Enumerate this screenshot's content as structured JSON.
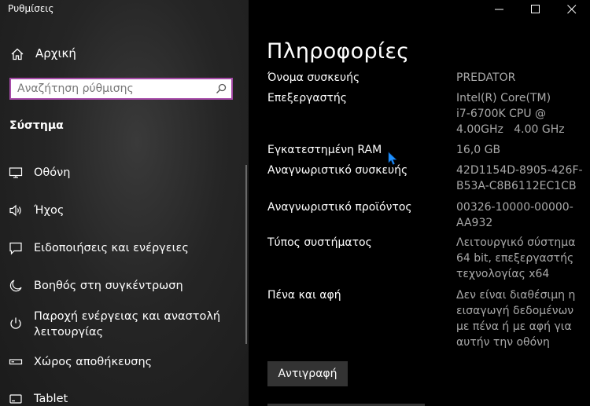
{
  "window": {
    "title": "Ρυθμίσεις"
  },
  "sidebar": {
    "home_label": "Αρχική",
    "search": {
      "placeholder": "Αναζήτηση ρύθμισης"
    },
    "section_title": "Σύστημα",
    "items": [
      {
        "label": "Οθόνη",
        "icon": "monitor-icon"
      },
      {
        "label": "Ήχος",
        "icon": "speaker-icon"
      },
      {
        "label": "Ειδοποιήσεις και ενέργειες",
        "icon": "notification-icon"
      },
      {
        "label": "Βοηθός στη συγκέντρωση",
        "icon": "moon-icon"
      },
      {
        "label_line1": "Παροχή ενέργειας και αναστολή",
        "label_line2": "λειτουργίας",
        "icon": "power-icon"
      },
      {
        "label": "Χώρος αποθήκευσης",
        "icon": "storage-icon"
      },
      {
        "label": "Tablet",
        "icon": "tablet-icon"
      }
    ]
  },
  "main": {
    "title": "Πληροφορίες",
    "specs": [
      {
        "label": "Όνομα συσκευής",
        "value": "PREDATOR"
      },
      {
        "label": "Επεξεργαστής",
        "value_lines": [
          "Intel(R) Core(TM)",
          "i7-6700K CPU @",
          "4.00GHz   4.00 GHz"
        ]
      },
      {
        "label": "Εγκατεστημένη RAM",
        "value": "16,0 GB"
      },
      {
        "label": "Αναγνωριστικό συσκευής",
        "value_lines": [
          "42D1154D-8905-426F-",
          "B53A-C8B6112EC1CB"
        ]
      },
      {
        "label": "Αναγνωριστικό προϊόντος",
        "value_lines": [
          "00326-10000-00000-",
          "AA932"
        ]
      },
      {
        "label": "Τύπος συστήματος",
        "value_lines": [
          "Λειτουργικό σύστημα",
          "64 bit, επεξεργαστής",
          "τεχνολογίας x64"
        ]
      },
      {
        "label": "Πένα και αφή",
        "value_lines": [
          "Δεν είναι διαθέσιμη η",
          "εισαγωγή δεδομένων",
          "με πένα ή με αφή για",
          "αυτήν την οθόνη"
        ]
      }
    ],
    "copy_label": "Αντιγραφή"
  },
  "colors": {
    "sidebar_bg": "#252525",
    "main_bg": "#000000",
    "search_border": "#a64aa8",
    "value_text": "#a9a9a9",
    "accent_cursor": "#1e90ff"
  }
}
